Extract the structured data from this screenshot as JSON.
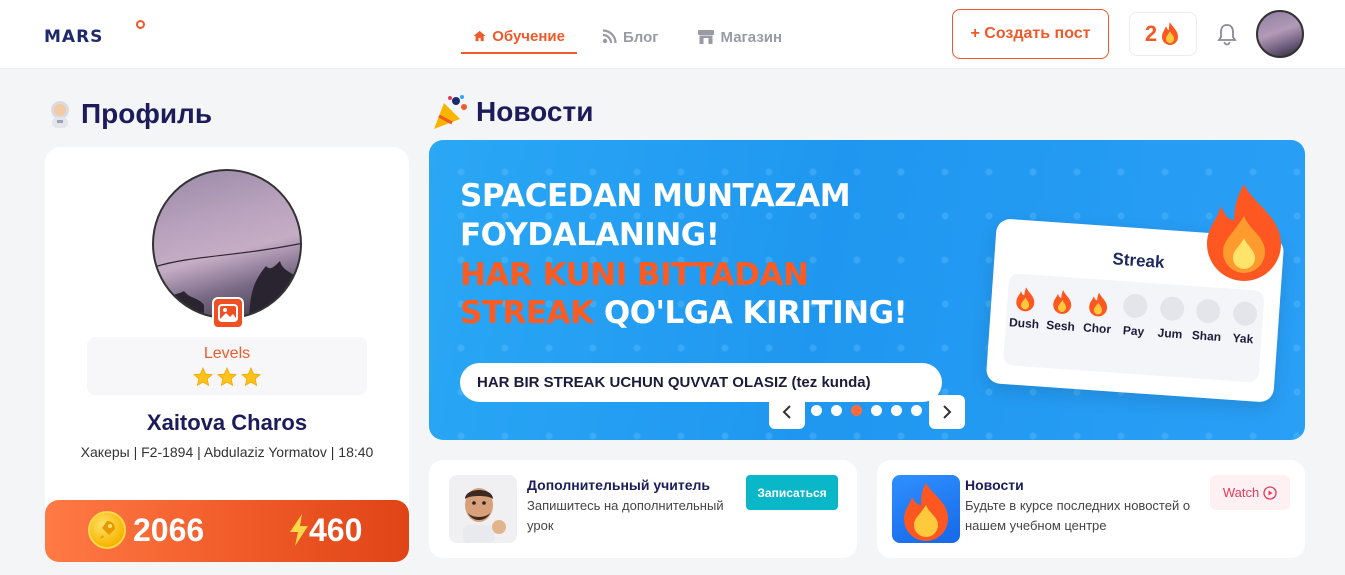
{
  "header": {
    "logo": "MARS",
    "nav": [
      {
        "label": "Обучение",
        "icon": "home-icon"
      },
      {
        "label": "Блог",
        "icon": "rss-icon"
      },
      {
        "label": "Магазин",
        "icon": "store-icon"
      }
    ],
    "create_post_label": "+ Создать пост",
    "streak_count": "2",
    "colors": {
      "accent": "#f05a28",
      "nav_inactive": "#9a9aa6"
    }
  },
  "profile": {
    "section_title": "Профиль",
    "levels_label": "Levels",
    "stars": 3,
    "name": "Xaitova Charos",
    "info": "Хакеры | F2-1894 | Abdulaziz Yormatov | 18:40",
    "coins": "2066",
    "energy": "460"
  },
  "news": {
    "section_title": "Новости",
    "banner": {
      "line1": "SPACEDAN MUNTAZAM",
      "line2": "FOYDALANING!",
      "line3": "HAR KUNI BITTADAN",
      "line4_orange": "STREAK",
      "line4_white": " QO'LGA KIRITING!",
      "pill": "HAR BIR STREAK UCHUN QUVVAT OLASIZ (tez kunda)",
      "streak_title": "Streak",
      "days": [
        {
          "label": "Dush",
          "done": true
        },
        {
          "label": "Sesh",
          "done": true
        },
        {
          "label": "Chor",
          "done": true
        },
        {
          "label": "Pay",
          "done": false
        },
        {
          "label": "Jum",
          "done": false
        },
        {
          "label": "Shan",
          "done": false
        },
        {
          "label": "Yak",
          "done": false
        }
      ]
    },
    "carousel": {
      "total": 6,
      "active_index": 2
    }
  },
  "cards": [
    {
      "title": "Дополнительный учитель",
      "desc": "Запишитесь на дополнительный урок",
      "button": "Записаться"
    },
    {
      "title": "Новости",
      "desc": "Будьте в курсе последних новостей о нашем учебном центре",
      "button": "Watch"
    }
  ]
}
